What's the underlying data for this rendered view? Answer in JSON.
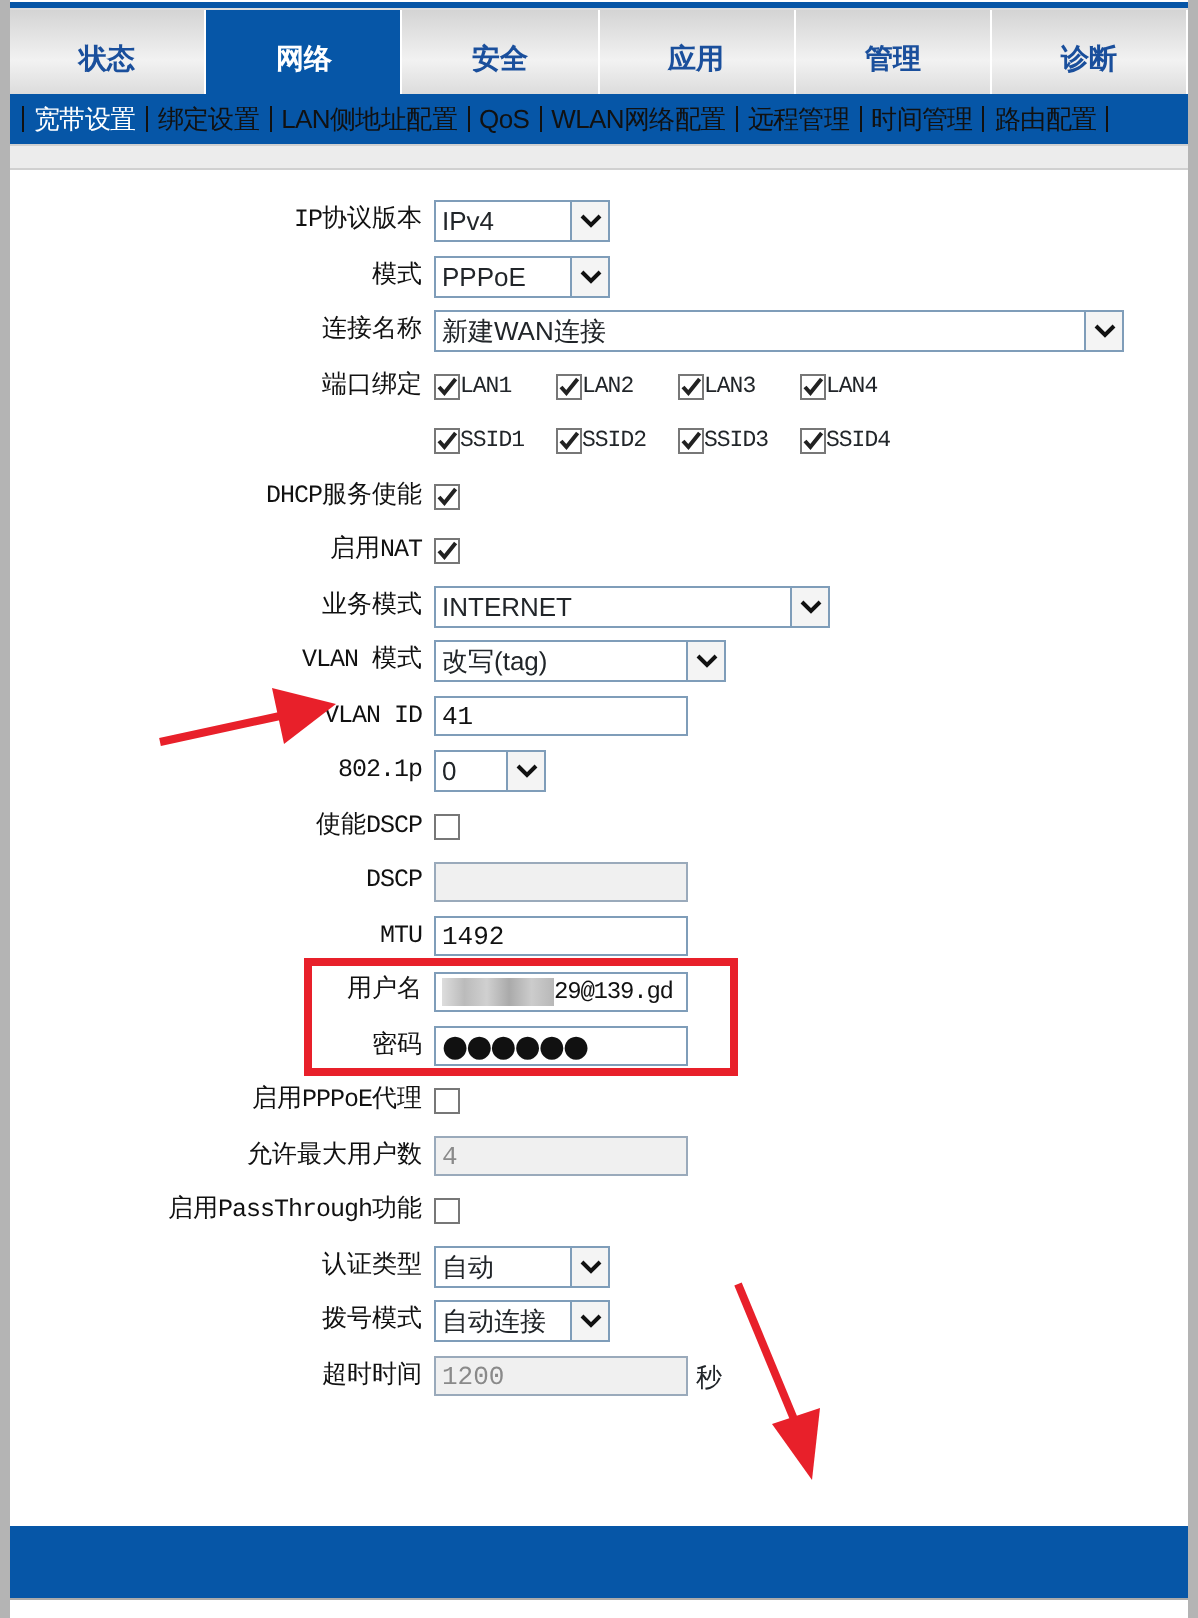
{
  "tabs": [
    {
      "label": "状态",
      "selected": false
    },
    {
      "label": "网络",
      "selected": true
    },
    {
      "label": "安全",
      "selected": false
    },
    {
      "label": "应用",
      "selected": false
    },
    {
      "label": "管理",
      "selected": false
    },
    {
      "label": "诊断",
      "selected": false
    }
  ],
  "subnav": [
    {
      "label": "宽带设置",
      "selected": true
    },
    {
      "label": "绑定设置",
      "selected": false
    },
    {
      "label": "LAN侧地址配置",
      "selected": false
    },
    {
      "label": "QoS",
      "selected": false
    },
    {
      "label": "WLAN网络配置",
      "selected": false
    },
    {
      "label": "远程管理",
      "selected": false
    },
    {
      "label": "时间管理",
      "selected": false
    },
    {
      "label": "路由配置",
      "selected": false
    }
  ],
  "form": [
    {
      "kind": "select",
      "label": "IP协议版本",
      "value": "IPv4"
    },
    {
      "kind": "select",
      "label": "模式",
      "value": "PPPoE"
    },
    {
      "kind": "select",
      "label": "连接名称",
      "value": "新建WAN连接"
    },
    {
      "kind": "checks",
      "label": "端口绑定",
      "options": [
        {
          "label": "LAN1",
          "checked": true
        },
        {
          "label": "LAN2",
          "checked": true
        },
        {
          "label": "LAN3",
          "checked": true
        },
        {
          "label": "LAN4",
          "checked": true
        }
      ]
    },
    {
      "kind": "checks",
      "options": [
        {
          "label": "SSID1",
          "checked": true
        },
        {
          "label": "SSID2",
          "checked": true
        },
        {
          "label": "SSID3",
          "checked": true
        },
        {
          "label": "SSID4",
          "checked": true
        }
      ]
    },
    {
      "kind": "checkbox",
      "label": "DHCP服务使能",
      "checked": true
    },
    {
      "kind": "checkbox",
      "label": "启用NAT",
      "checked": true
    },
    {
      "kind": "select",
      "label": "业务模式",
      "value": "INTERNET"
    },
    {
      "kind": "select",
      "label": "VLAN 模式",
      "value": "改写(tag)"
    },
    {
      "kind": "text",
      "label": "VLAN ID",
      "value": "41",
      "disabled": false
    },
    {
      "kind": "select",
      "label": "802.1p",
      "value": "0"
    },
    {
      "kind": "checkbox",
      "label": "使能DSCP",
      "checked": false
    },
    {
      "kind": "text",
      "label": "DSCP",
      "disabled": true
    },
    {
      "kind": "text",
      "label": "MTU",
      "value": "1492",
      "disabled": false
    },
    {
      "kind": "text",
      "label": "用户名",
      "value": "29@139.gd",
      "disabled": false,
      "blurred": true
    },
    {
      "kind": "password",
      "label": "密码",
      "value": "●●●●●●"
    },
    {
      "kind": "checkbox",
      "label": "启用PPPoE代理",
      "checked": false
    },
    {
      "kind": "text",
      "label": "允许最大用户数",
      "value": "4",
      "disabled": true
    },
    {
      "kind": "checkbox",
      "label": "启用PassThrough功能",
      "checked": false
    },
    {
      "kind": "select",
      "label": "认证类型",
      "value": "自动"
    },
    {
      "kind": "select",
      "label": "拨号模式",
      "value": "自动连接"
    },
    {
      "kind": "text",
      "label": "超时时间",
      "value": "1200",
      "disabled": true,
      "unit": "秒"
    }
  ]
}
